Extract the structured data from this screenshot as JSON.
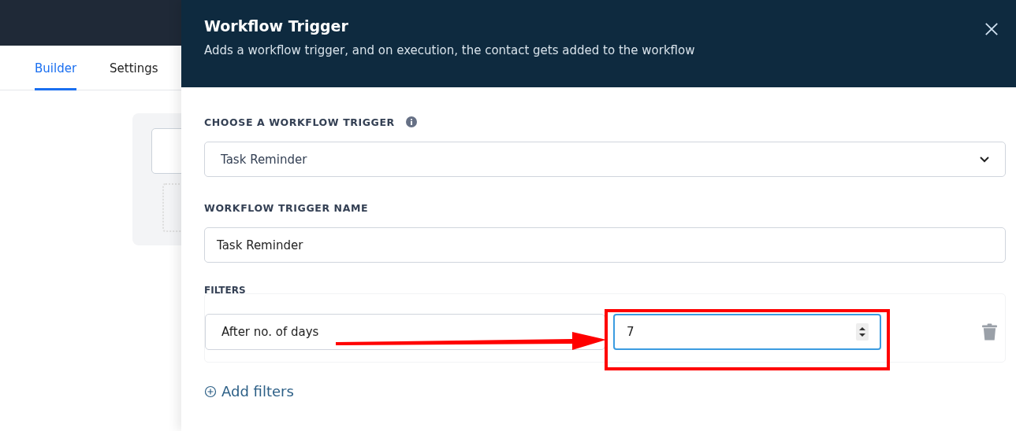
{
  "tabs": [
    {
      "label": "Builder",
      "selected": true
    },
    {
      "label": "Settings",
      "selected": false
    }
  ],
  "drawer": {
    "title": "Workflow Trigger",
    "subtitle": "Adds a workflow trigger, and on execution, the contact gets added to the workflow",
    "trigger_label": "CHOOSE A WORKFLOW TRIGGER",
    "trigger_value": "Task Reminder",
    "name_label": "WORKFLOW TRIGGER NAME",
    "name_value": "Task Reminder",
    "filters_label": "FILTERS",
    "filters": [
      {
        "field": "After no. of days",
        "value": "7",
        "focused": true
      }
    ],
    "add_filters": "Add filters"
  }
}
